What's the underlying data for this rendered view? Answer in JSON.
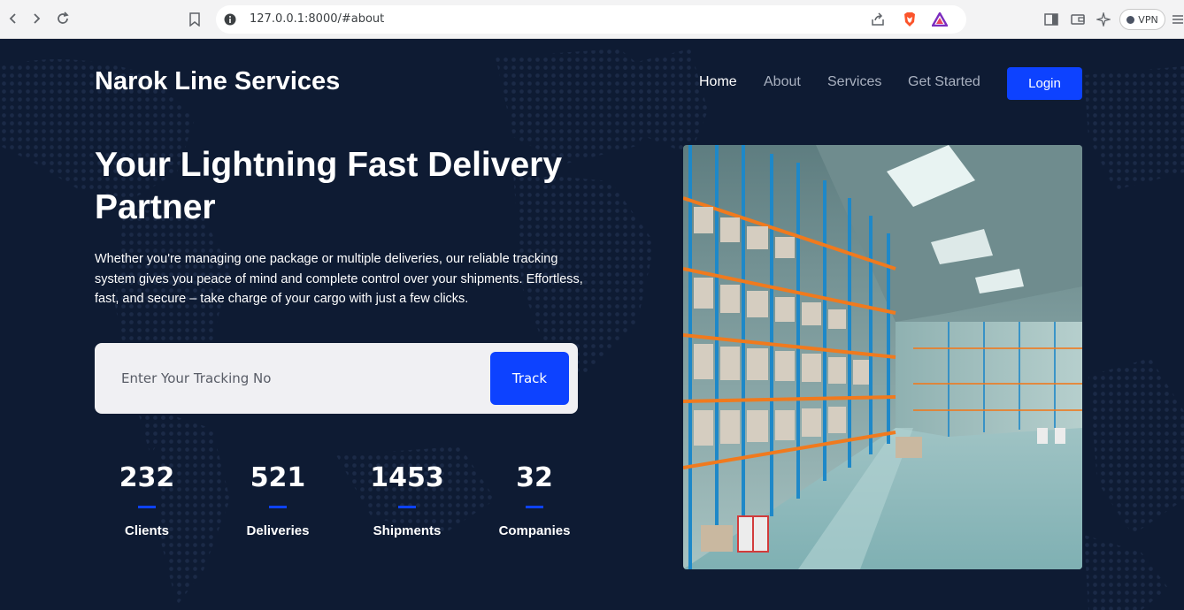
{
  "browser": {
    "url": "127.0.0.1:8000/#about",
    "vpn_label": "VPN"
  },
  "header": {
    "brand": "Narok Line Services",
    "nav": [
      {
        "label": "Home"
      },
      {
        "label": "About"
      },
      {
        "label": "Services"
      },
      {
        "label": "Get Started"
      }
    ],
    "login_label": "Login"
  },
  "hero": {
    "headline_line1": "Your Lightning Fast Delivery",
    "headline_line2": "Partner",
    "description": "Whether you're managing one package or multiple deliveries, our reliable tracking system gives you peace of mind and complete control over your shipments. Effortless, fast, and secure – take charge of your cargo with just a few clicks.",
    "tracking_placeholder": "Enter Your Tracking No",
    "track_label": "Track"
  },
  "stats": [
    {
      "value": "232",
      "label": "Clients"
    },
    {
      "value": "521",
      "label": "Deliveries"
    },
    {
      "value": "1453",
      "label": "Shipments"
    },
    {
      "value": "32",
      "label": "Companies"
    }
  ],
  "colors": {
    "background": "#0e1b33",
    "accent": "#0d42ff",
    "muted_nav": "#a9b1c0"
  }
}
